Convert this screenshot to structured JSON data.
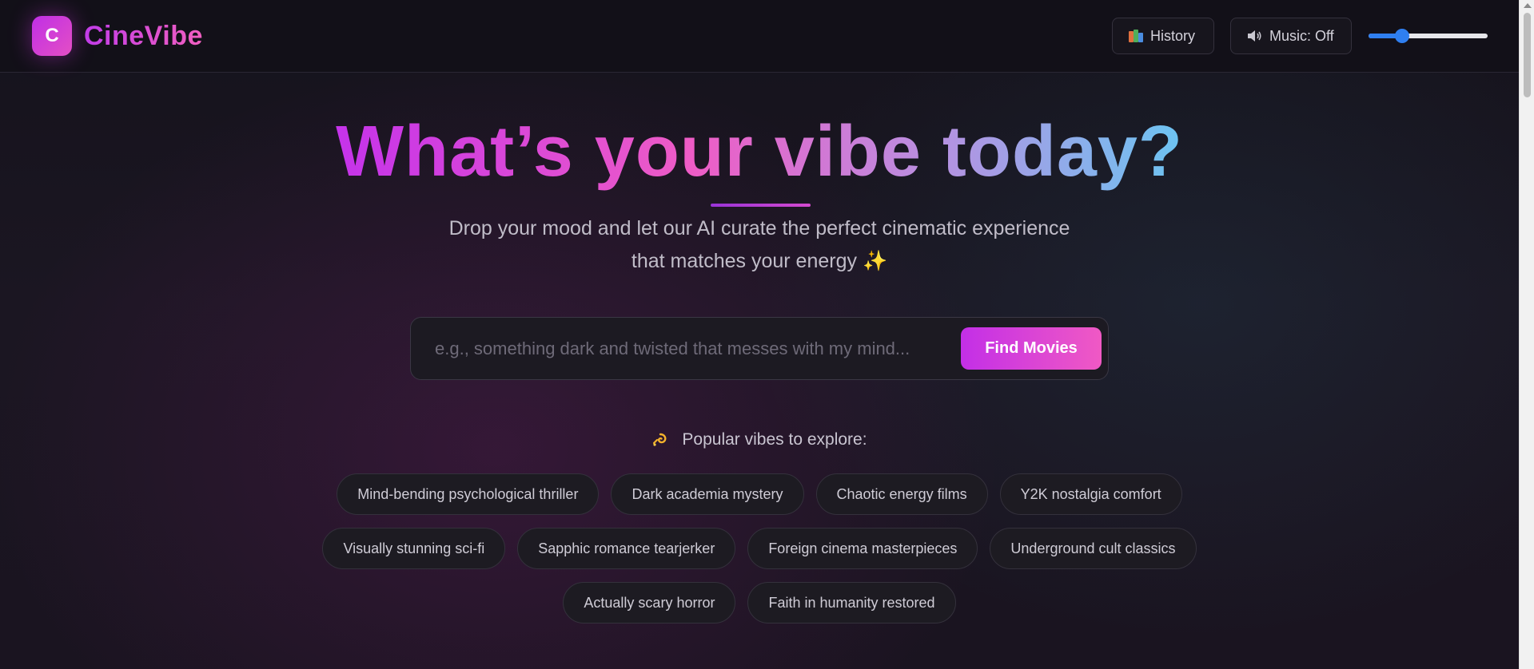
{
  "header": {
    "logo_letter": "C",
    "brand": "CineVibe",
    "history_label": "History",
    "music_label": "Music: Off",
    "volume_level": 0.28
  },
  "hero": {
    "title": "What’s your vibe today?",
    "subtitle": "Drop your mood and let our AI curate the perfect cinematic experience that matches your energy ✨"
  },
  "search": {
    "placeholder": "e.g., something dark and twisted that messes with my mind...",
    "value": "",
    "button_label": "Find Movies"
  },
  "popular": {
    "heading": "Popular vibes to explore:",
    "rows": [
      [
        "Mind-bending psychological thriller",
        "Dark academia mystery",
        "Chaotic energy films",
        "Y2K nostalgia comfort"
      ],
      [
        "Visually stunning sci-fi",
        "Sapphic romance tearjerker",
        "Foreign cinema masterpieces",
        "Underground cult classics"
      ],
      [
        "Actually scary horror",
        "Faith in humanity restored"
      ]
    ]
  },
  "icons": {
    "history": "books-icon",
    "music": "speaker-icon",
    "popular": "dizzy-icon"
  },
  "colors": {
    "accent_start": "#c533ea",
    "accent_end": "#f059c4",
    "title_end": "#6cc4f2",
    "slider": "#2f7ff0"
  }
}
